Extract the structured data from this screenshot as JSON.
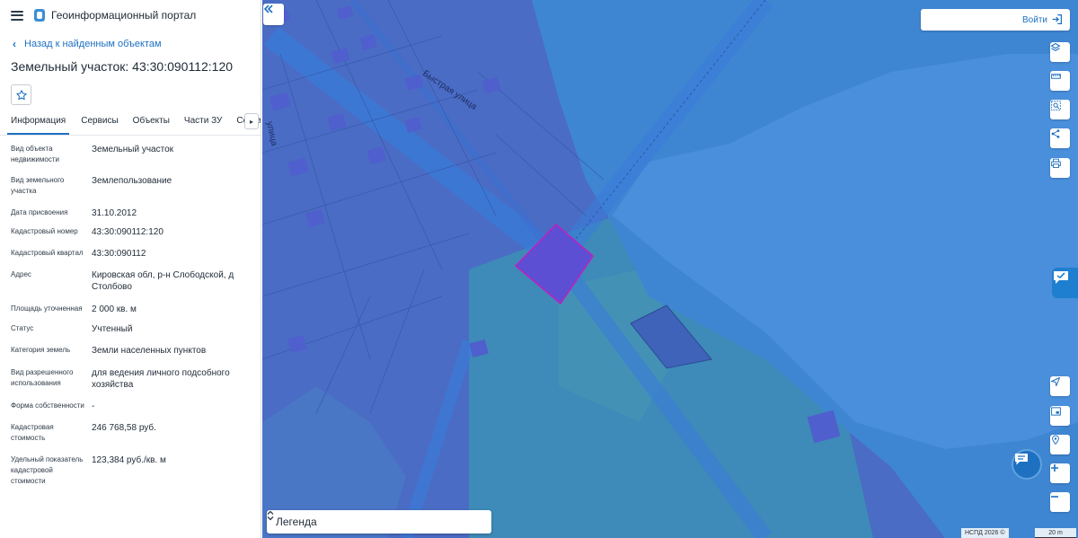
{
  "header": {
    "title": "Геоинформационный портал"
  },
  "nav": {
    "back_label": "Назад к найденным объектам"
  },
  "object": {
    "title": "Земельный участок: 43:30:090112:120"
  },
  "tabs": [
    {
      "label": "Информация",
      "active": true
    },
    {
      "label": "Сервисы",
      "active": false
    },
    {
      "label": "Объекты",
      "active": false
    },
    {
      "label": "Части ЗУ",
      "active": false
    },
    {
      "label": "Состав",
      "active": false
    }
  ],
  "attributes": [
    {
      "key": "Вид объекта недвижимости",
      "value": "Земельный участок"
    },
    {
      "key": "Вид земельного участка",
      "value": "Землепользование"
    },
    {
      "key": "Дата присвоения",
      "value": "31.10.2012"
    },
    {
      "key": "Кадастровый номер",
      "value": "43:30:090112:120"
    },
    {
      "key": "Кадастровый квартал",
      "value": "43:30:090112"
    },
    {
      "key": "Адрес",
      "value": "Кировская обл, р-н Слободской, д Столбово"
    },
    {
      "key": "Площадь уточненная",
      "value": "2 000 кв. м"
    },
    {
      "key": "Статус",
      "value": "Учтенный"
    },
    {
      "key": "Категория земель",
      "value": "Земли населенных пунктов"
    },
    {
      "key": "Вид разрешенного использования",
      "value": "для ведения личного подсобного хозяйства"
    },
    {
      "key": "Форма собственности",
      "value": "-"
    },
    {
      "key": "Кадастровая стоимость",
      "value": "246 768,58 руб."
    },
    {
      "key": "Удельный показатель кадастровой стоимости",
      "value": "123,384 руб./кв. м"
    }
  ],
  "map": {
    "login_label": "Войти",
    "legend_label": "Легенда",
    "street_label_1": "Быстрая улица",
    "street_label_2": "улица",
    "copyright": "НСПД 2026 ©",
    "scale_label": "20 m",
    "tools_top": [
      "layers-icon",
      "ruler-icon",
      "select-area-icon",
      "share-icon",
      "print-icon"
    ],
    "tools_bottom": [
      "locate-icon",
      "minimap-icon",
      "geo-pin-icon",
      "zoom-in-icon",
      "zoom-out-icon"
    ],
    "colors": {
      "water": "#3f86d2",
      "land": "#4a6cc4",
      "green_zone": "#3e8ab8",
      "selected_parcel": "#c01fbf",
      "accent": "#1e70c1"
    }
  }
}
